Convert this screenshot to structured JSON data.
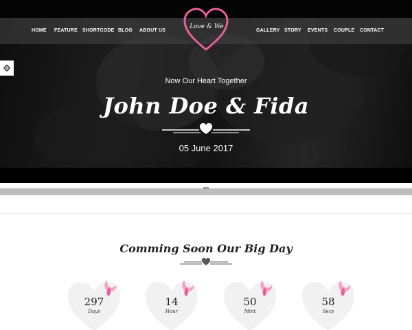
{
  "nav": {
    "left": [
      "HOME",
      "FEATURE",
      "SHORTCODE",
      "BLOG",
      "ABOUT US"
    ],
    "right": [
      "GALLERY",
      "STORY",
      "EVENTS",
      "COUPLE",
      "CONTACT"
    ]
  },
  "logo": {
    "text": "Love & We"
  },
  "hero": {
    "tagline": "Now Our Heart Together",
    "couple": "John Doe & Fida",
    "date": "05 June 2017"
  },
  "countdown": {
    "title": "Comming Soon Our Big Day",
    "items": [
      {
        "value": "297",
        "label": "Days"
      },
      {
        "value": "14",
        "label": "Hour"
      },
      {
        "value": "50",
        "label": "Mint"
      },
      {
        "value": "58",
        "label": "Secs"
      }
    ]
  },
  "colors": {
    "accent": "#e8609a",
    "heart_fill": "#f1f1f1",
    "ribbon": "#f5a3c3"
  },
  "icons": {
    "settings": "gear-icon",
    "logo": "heart-outline-icon",
    "divider": "heart-icon"
  }
}
